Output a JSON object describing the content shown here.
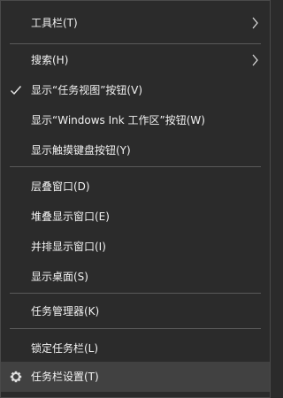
{
  "menu": {
    "items": [
      {
        "label": "工具栏(T)"
      },
      {
        "label": "搜索(H)"
      },
      {
        "label": "显示“任务视图”按钮(V)"
      },
      {
        "label": "显示“Windows Ink 工作区”按钮(W)"
      },
      {
        "label": "显示触摸键盘按钮(Y)"
      },
      {
        "label": "层叠窗口(D)"
      },
      {
        "label": "堆叠显示窗口(E)"
      },
      {
        "label": "并排显示窗口(I)"
      },
      {
        "label": "显示桌面(S)"
      },
      {
        "label": "任务管理器(K)"
      },
      {
        "label": "锁定任务栏(L)"
      },
      {
        "label": "任务栏设置(T)"
      }
    ]
  },
  "colors": {
    "background": "#2b2b2b",
    "hover": "#414141",
    "text": "#f2f2f2",
    "separator": "#5a5a5a"
  },
  "icons": {
    "submenu": "chevron-right-icon",
    "checked": "checkmark-icon",
    "settings": "gear-icon"
  }
}
